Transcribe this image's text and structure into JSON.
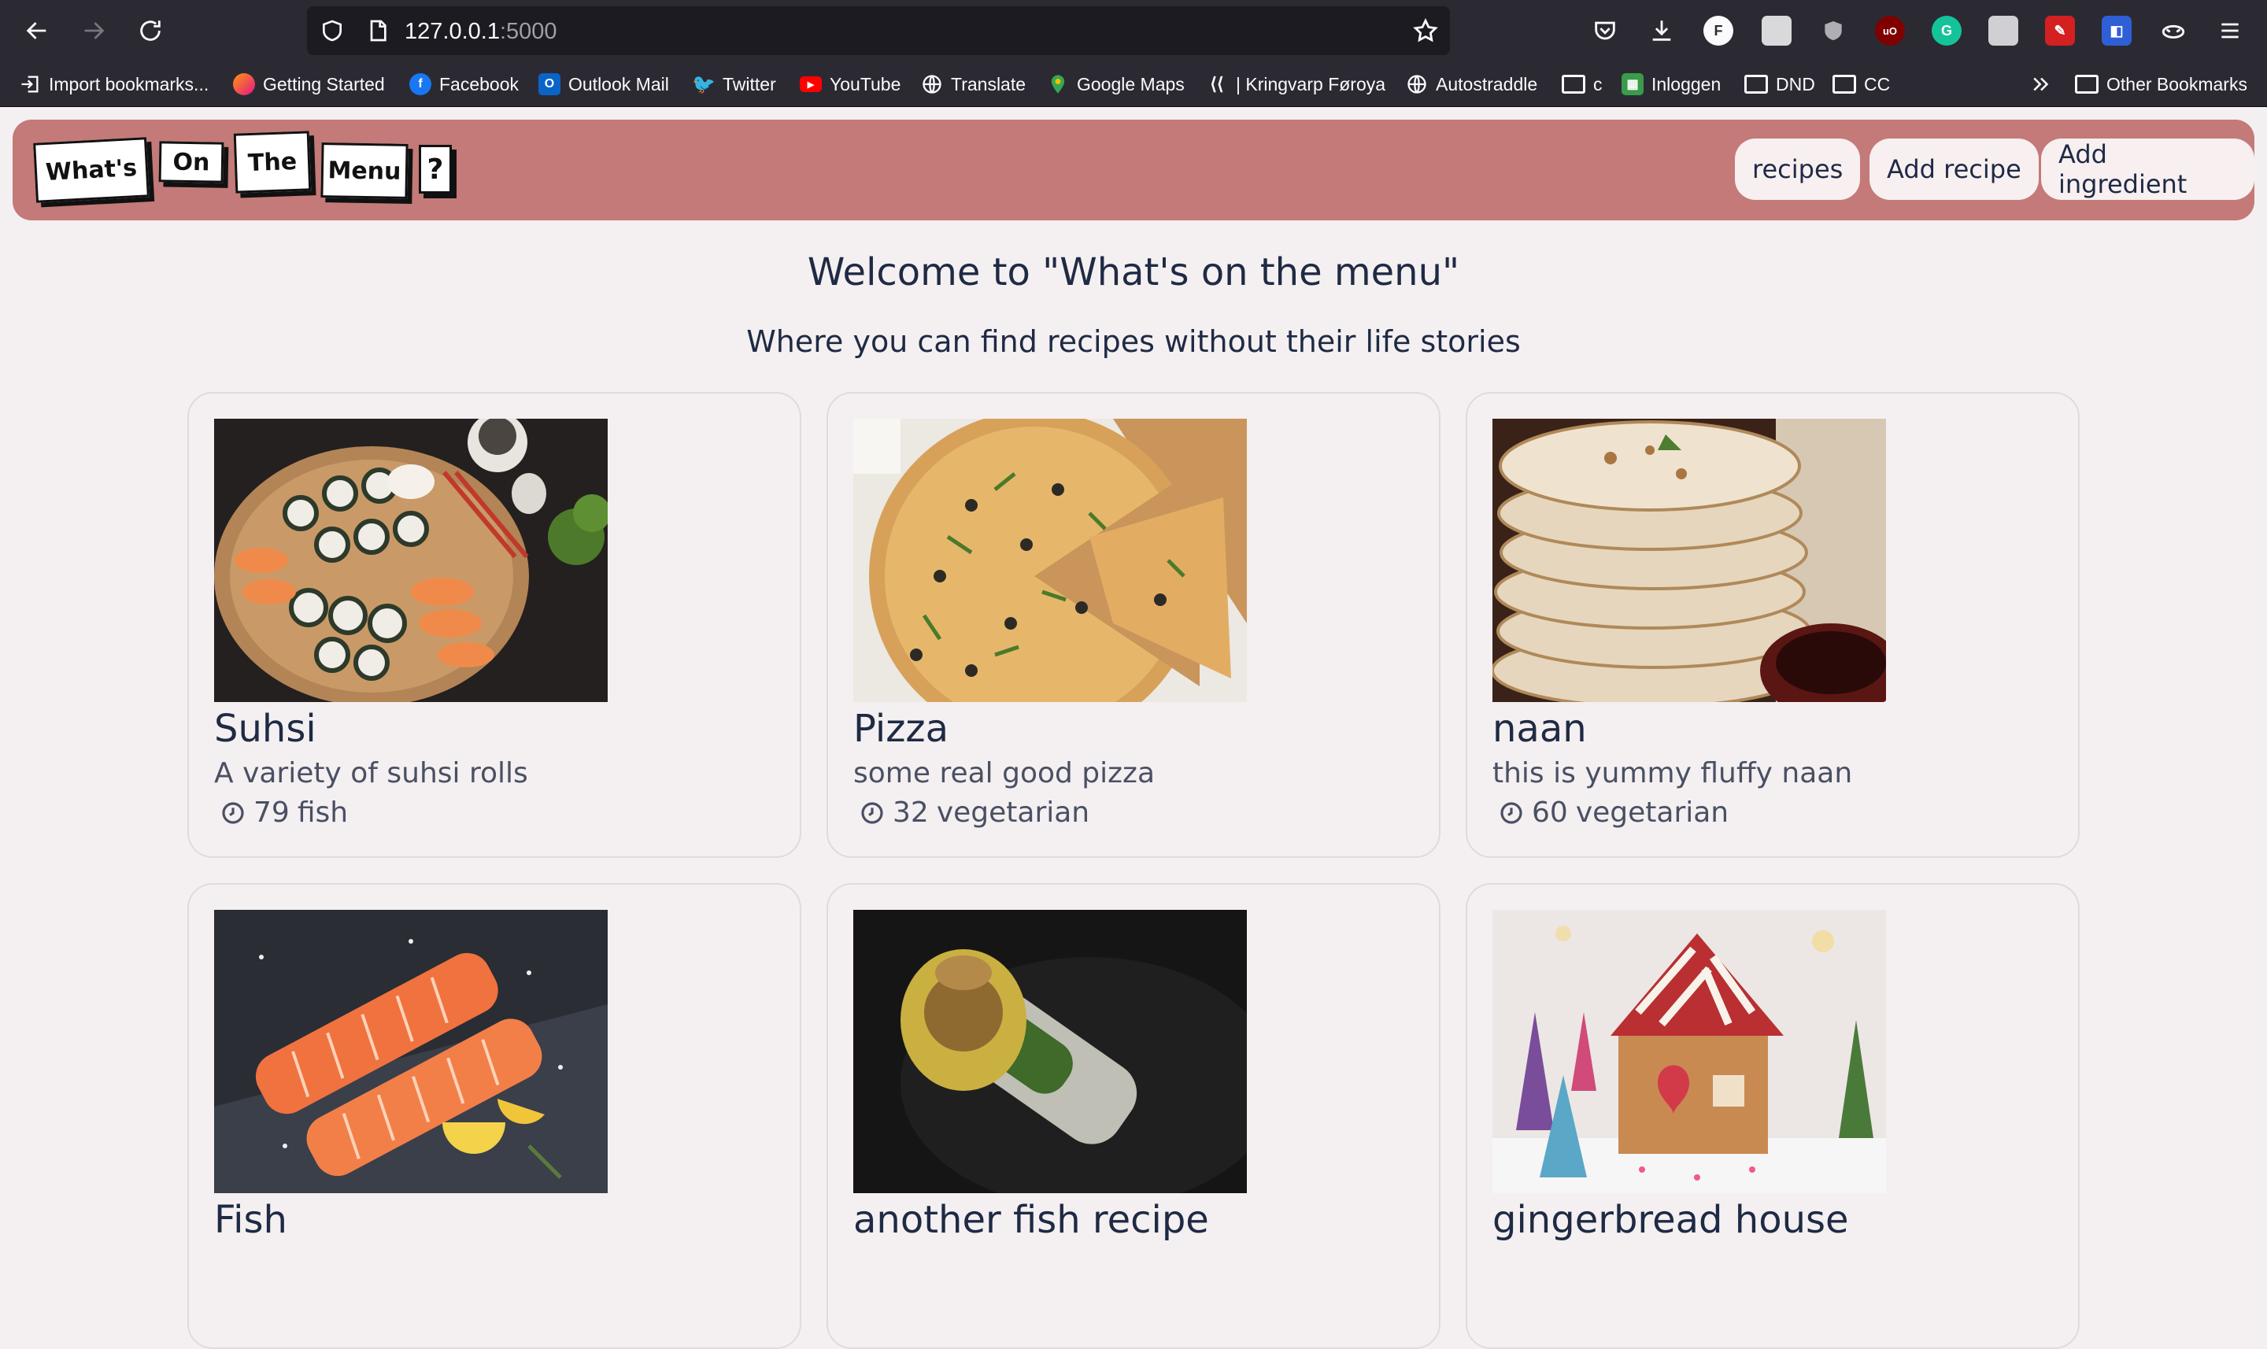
{
  "browser": {
    "url_host": "127.0.0.1",
    "url_port": ":5000",
    "bookmarks": [
      {
        "label": "Import bookmarks...",
        "icon": "import-icon"
      },
      {
        "label": "Getting Started",
        "icon": "firefox-icon"
      },
      {
        "label": "Facebook",
        "icon": "facebook-icon"
      },
      {
        "label": "Outlook Mail",
        "icon": "outlook-icon"
      },
      {
        "label": "Twitter",
        "icon": "twitter-icon"
      },
      {
        "label": "YouTube",
        "icon": "youtube-icon"
      },
      {
        "label": "Translate",
        "icon": "globe-icon"
      },
      {
        "label": "Google Maps",
        "icon": "maps-pin-icon"
      },
      {
        "label": "| Kringvarp Føroya",
        "icon": "kringvarp-icon"
      },
      {
        "label": "Autostraddle",
        "icon": "globe-icon"
      },
      {
        "label": "c",
        "icon": "folder-icon"
      },
      {
        "label": "Inloggen",
        "icon": "inloggen-icon"
      },
      {
        "label": "DND",
        "icon": "folder-icon"
      },
      {
        "label": "CC",
        "icon": "folder-icon"
      }
    ],
    "other_bookmarks": "Other Bookmarks"
  },
  "site": {
    "logo_words": [
      "What's",
      "On",
      "The",
      "Menu",
      "?"
    ],
    "nav": [
      "recipes",
      "Add recipe",
      "Add ingredient"
    ],
    "welcome": "Welcome to \"What's on the menu\"",
    "subtitle": "Where you can find recipes without their life stories"
  },
  "recipes": [
    {
      "title": "Suhsi",
      "description": "A variety of suhsi rolls",
      "time": "79",
      "category": "fish",
      "image": "sushi-platter"
    },
    {
      "title": "Pizza",
      "description": "some real good pizza",
      "time": "32",
      "category": "vegetarian",
      "image": "pizza"
    },
    {
      "title": "naan",
      "description": "this is yummy fluffy naan",
      "time": "60",
      "category": "vegetarian",
      "image": "naan-stack"
    },
    {
      "title": "Fish",
      "image": "salmon-fillets"
    },
    {
      "title": "another fish recipe",
      "image": "fish-wrap"
    },
    {
      "title": "gingerbread house",
      "image": "gingerbread-house"
    }
  ],
  "colors": {
    "header_bg": "#c47a78",
    "page_bg": "#f4f0f1",
    "text_dark": "#1f2a44"
  }
}
